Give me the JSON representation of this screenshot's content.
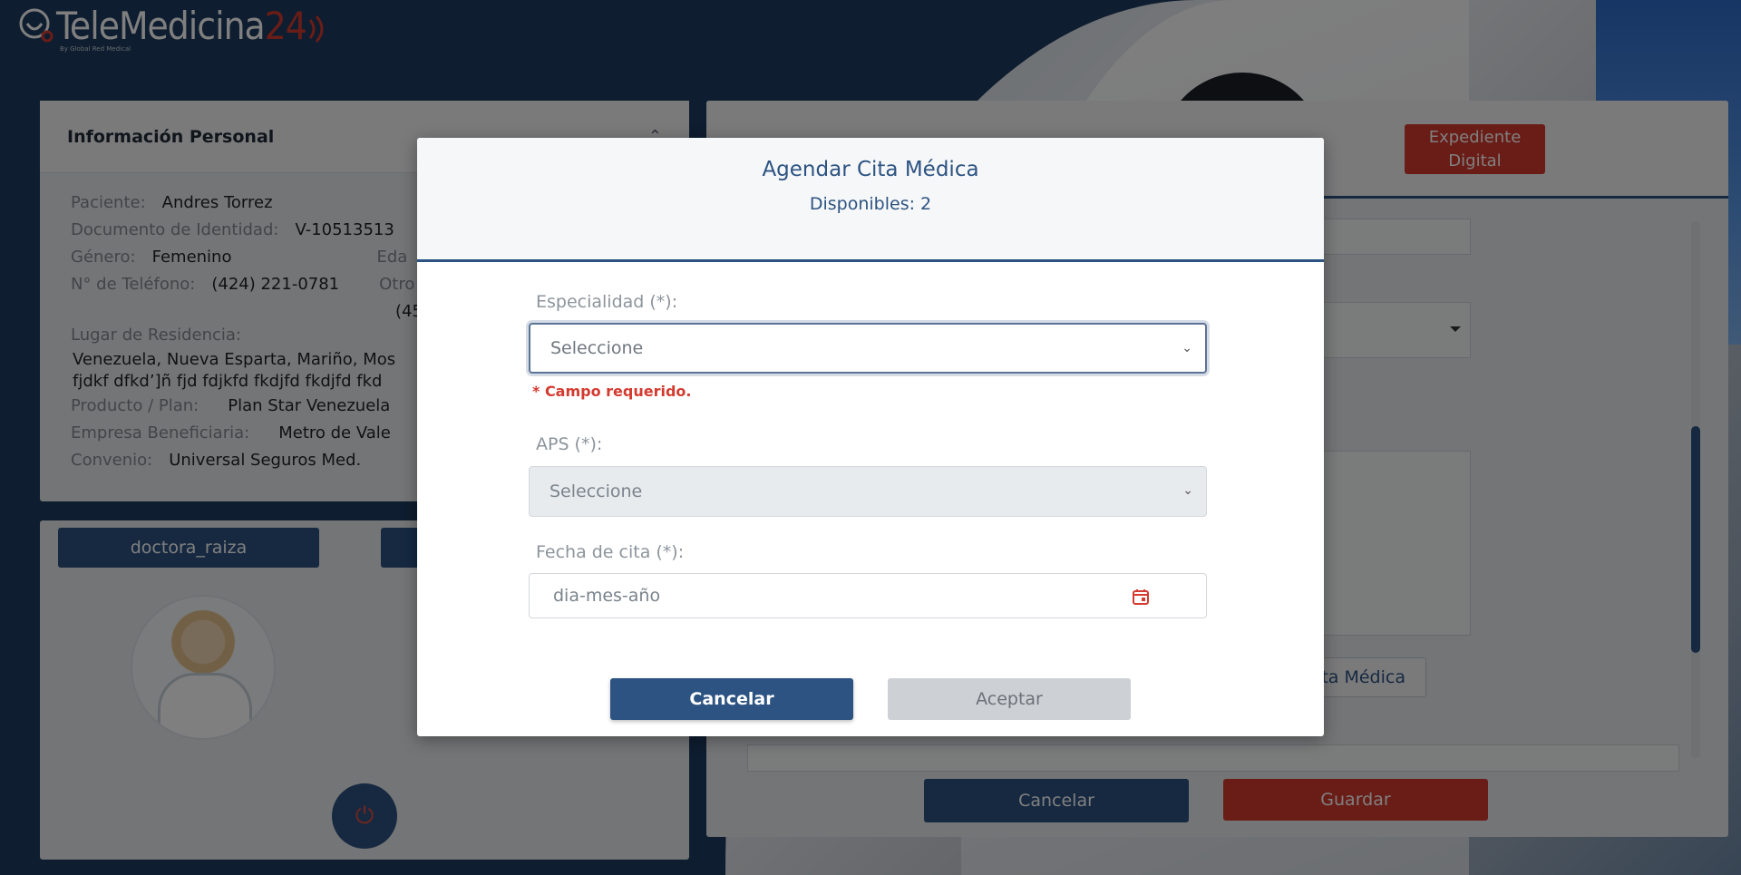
{
  "logo": {
    "name": "TeleMedicina",
    "number": "24",
    "tagline": "By Global Red Medical"
  },
  "personal": {
    "title": "Información Personal",
    "rows": [
      {
        "label": "Paciente:",
        "value": "Andres Torrez"
      },
      {
        "label": "Documento de Identidad:",
        "value": "V-10513513"
      },
      {
        "label": "Género:",
        "value": "Femenino"
      },
      {
        "label": "N° de Teléfono:",
        "value": "(424) 221-0781"
      },
      {
        "label": "Lugar de Residencia:",
        "value": ""
      },
      {
        "label": "Producto / Plan:",
        "value": "Plan Star Venezuela"
      },
      {
        "label": "Empresa Beneficiaria:",
        "value": "Metro de Vale"
      },
      {
        "label": "Convenio:",
        "value": "Universal Seguros Med."
      }
    ],
    "residence_line1": "Venezuela, Nueva Esparta, Mariño, Mos",
    "residence_line2": "fjdkf dfkd’]ñ fjd fdjkfd fkdjfd fkdjfd fkd",
    "extra_label": "Otro",
    "extra_value": "(45",
    "edad_label": "Eda"
  },
  "doctor": {
    "button_label": "doctora_raiza"
  },
  "right_panel": {
    "expediente_label": "Expediente Digital",
    "cita_button_label": "ta Médica",
    "cancel_label": "Cancelar",
    "save_label": "Guardar"
  },
  "modal": {
    "title": "Agendar Cita Médica",
    "subtitle": "Disponibles: 2",
    "especialidad_label": "Especialidad (*):",
    "especialidad_value": "Seleccione",
    "error_text": "* Campo requerido.",
    "aps_label": "APS (*):",
    "aps_value": "Seleccione",
    "fecha_label": "Fecha de cita (*):",
    "fecha_placeholder": "dia-mes-año",
    "cancel_label": "Cancelar",
    "accept_label": "Aceptar"
  },
  "colors": {
    "primary": "#2c5382",
    "danger": "#d43a2f"
  }
}
